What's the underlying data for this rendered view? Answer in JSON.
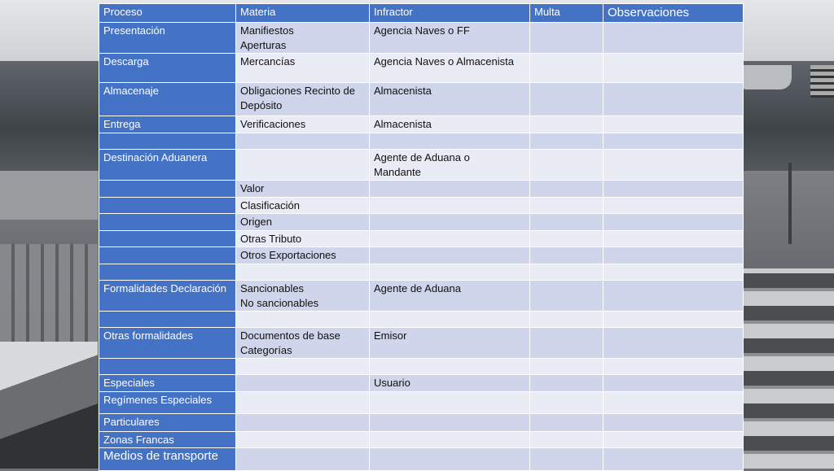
{
  "table": {
    "headers": [
      "Proceso",
      "Materia",
      "Infractor",
      "Multa",
      "Observaciones"
    ],
    "rows": [
      {
        "proceso": "Presentación",
        "materia": [
          "Manifiestos",
          "Aperturas"
        ],
        "infractor": [
          "Agencia Naves o FF"
        ]
      },
      {
        "proceso": "Descarga",
        "materia": [
          "Mercancías"
        ],
        "infractor": [
          "Agencia Naves o Almacenista"
        ]
      },
      {
        "proceso": "Almacenaje",
        "materia": [
          "Obligaciones Recinto de",
          "Depósito"
        ],
        "infractor": [
          "Almacenista"
        ]
      },
      {
        "proceso": "Entrega",
        "materia": [
          "Verificaciones"
        ],
        "infractor": [
          "Almacenista"
        ]
      },
      {
        "proceso": "",
        "materia": [],
        "infractor": []
      },
      {
        "proceso": "Destinación Aduanera",
        "materia": [],
        "infractor": [
          "Agente de Aduana o",
          "Mandante"
        ]
      },
      {
        "proceso": "",
        "materia": [
          "Valor"
        ],
        "infractor": []
      },
      {
        "proceso": "",
        "materia": [
          "Clasificación"
        ],
        "infractor": []
      },
      {
        "proceso": "",
        "materia": [
          "Origen"
        ],
        "infractor": []
      },
      {
        "proceso": "",
        "materia": [
          "Otras Tributo"
        ],
        "infractor": []
      },
      {
        "proceso": "",
        "materia": [
          "Otros Exportaciones"
        ],
        "infractor": []
      },
      {
        "proceso": "",
        "materia": [],
        "infractor": []
      },
      {
        "proceso": "Formalidades Declaración",
        "materia": [
          "Sancionables",
          "No sancionables"
        ],
        "infractor": [
          "Agente de Aduana"
        ]
      },
      {
        "proceso": "",
        "materia": [],
        "infractor": []
      },
      {
        "proceso": "Otras formalidades",
        "materia": [
          "Documentos de base",
          "Categorías"
        ],
        "infractor": [
          "Emisor"
        ]
      },
      {
        "proceso": "",
        "materia": [],
        "infractor": []
      },
      {
        "proceso": "Especiales",
        "materia": [],
        "infractor": [
          "Usuario"
        ]
      },
      {
        "proceso": "Regímenes Especiales",
        "materia": [],
        "infractor": []
      },
      {
        "proceso": "Particulares",
        "materia": [],
        "infractor": []
      },
      {
        "proceso": "Zonas Francas",
        "materia": [],
        "infractor": []
      },
      {
        "proceso": "Medios de transporte",
        "materia": [],
        "infractor": []
      }
    ]
  },
  "colors": {
    "header": "#4472c4",
    "row_odd": "#cfd5ea",
    "row_even": "#e9ebf5",
    "border": "#ffffff"
  }
}
